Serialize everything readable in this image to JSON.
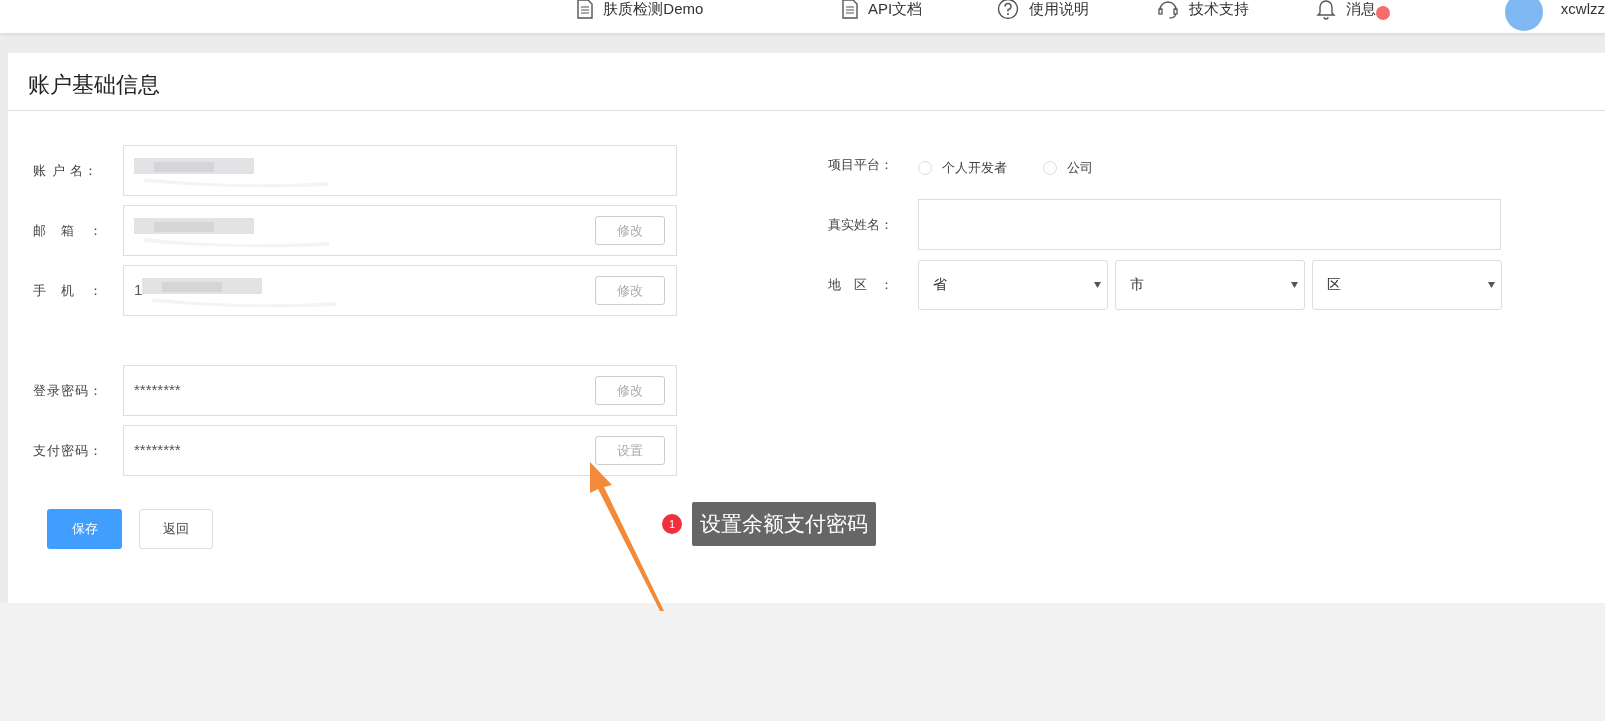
{
  "header": {
    "nav": [
      {
        "kind": "doc",
        "label": "肤质检测Demo",
        "badge": false
      },
      {
        "kind": "doc",
        "label": "API文档",
        "badge": false
      },
      {
        "kind": "help",
        "label": "使用说明",
        "badge": false
      },
      {
        "kind": "support",
        "label": "技术支持",
        "badge": false
      },
      {
        "kind": "bell",
        "label": "消息",
        "badge": true
      }
    ],
    "user": {
      "name": "xcwlzz"
    }
  },
  "title": "账户基础信息",
  "contact_fields": [
    {
      "label": "账 户 名：",
      "redacted": true
    },
    {
      "label": "邮　箱　：",
      "redacted": true,
      "button": "修改"
    },
    {
      "label": "手　机　：",
      "value": "1",
      "redacted": true,
      "button": "修改"
    }
  ],
  "password_fields": [
    {
      "label": "登录密码：",
      "value": "********",
      "button": "修改"
    },
    {
      "label": "支付密码：",
      "value": "********",
      "button": "设置"
    }
  ],
  "platform": {
    "label": "项目平台：",
    "options": [
      {
        "label": "个人开发者",
        "selected": false
      },
      {
        "label": "公司",
        "selected": false
      }
    ]
  },
  "real_name": {
    "label": "真实姓名："
  },
  "region": {
    "label": "地　区　：",
    "selects": [
      "省",
      "市",
      "区"
    ]
  },
  "actions": [
    {
      "kind": "primary",
      "label": "保存"
    },
    {
      "kind": "default",
      "label": "返回"
    }
  ],
  "annotation": {
    "number": "1",
    "text": "设置余额支付密码"
  }
}
